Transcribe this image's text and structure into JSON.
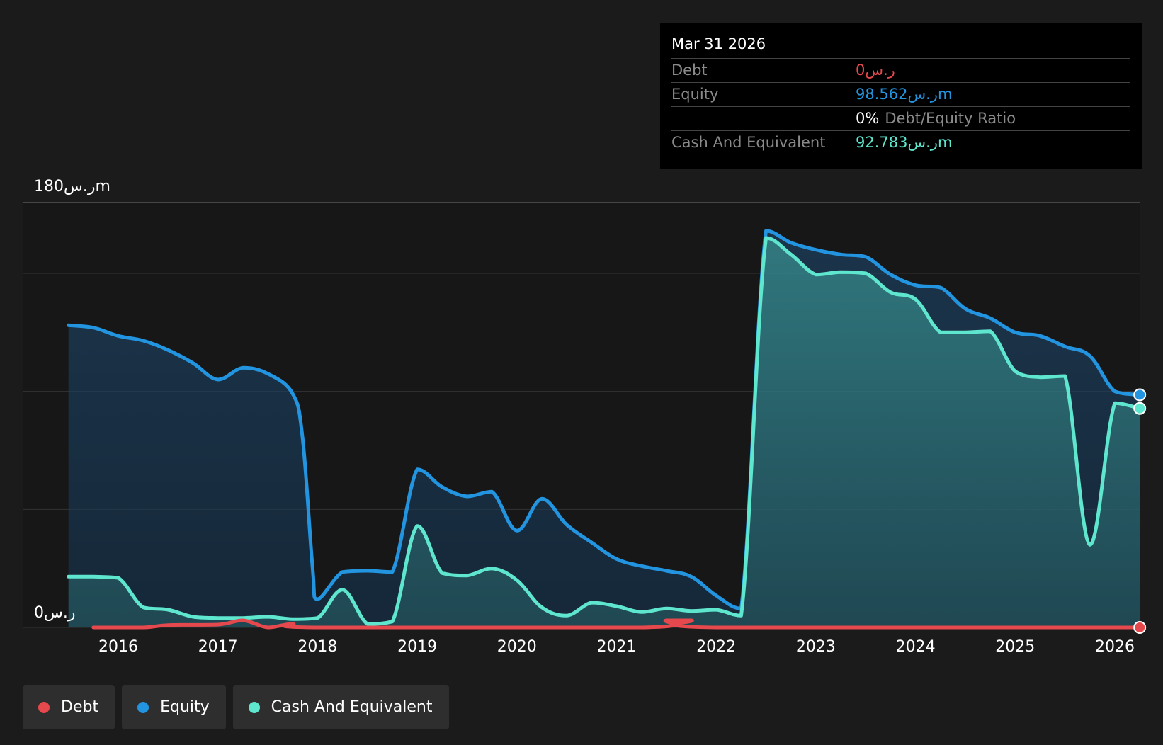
{
  "colors": {
    "background": "#1b1b1b",
    "debt": "#e5484d",
    "equity": "#2394df",
    "cash": "#5ee6cf",
    "grid": "#333333"
  },
  "tooltip": {
    "date": "Mar 31 2026",
    "debt_label": "Debt",
    "debt_value": "0ر.س",
    "equity_label": "Equity",
    "equity_value": "98.562ر.سm",
    "ratio_value": "0%",
    "ratio_label": "Debt/Equity Ratio",
    "cash_label": "Cash And Equivalent",
    "cash_value": "92.783ر.سm"
  },
  "legend": {
    "debt": "Debt",
    "equity": "Equity",
    "cash": "Cash And Equivalent"
  },
  "chart_data": {
    "type": "area",
    "y_top_label": "180ر.سm",
    "y_bottom_label": "0ر.س",
    "ylim": [
      0,
      180
    ],
    "xlim": [
      2015.1,
      2026.3
    ],
    "x_ticks": [
      "2016",
      "2017",
      "2018",
      "2019",
      "2020",
      "2021",
      "2022",
      "2023",
      "2024",
      "2025",
      "2026"
    ],
    "grid": true,
    "legend_position": "bottom-left",
    "series": [
      {
        "name": "Equity",
        "color": "#2394df",
        "points": [
          [
            2015.5,
            128
          ],
          [
            2015.75,
            127
          ],
          [
            2016.0,
            123.5
          ],
          [
            2016.25,
            121.5
          ],
          [
            2016.5,
            117.5
          ],
          [
            2016.75,
            112
          ],
          [
            2017.0,
            105
          ],
          [
            2017.25,
            110
          ],
          [
            2017.5,
            107.5
          ],
          [
            2017.75,
            99
          ],
          [
            2017.85,
            80
          ],
          [
            2017.95,
            25
          ],
          [
            2018.0,
            12
          ],
          [
            2018.25,
            23.5
          ],
          [
            2018.5,
            24
          ],
          [
            2018.75,
            23.5
          ],
          [
            2019.0,
            67
          ],
          [
            2019.25,
            59.5
          ],
          [
            2019.5,
            55.5
          ],
          [
            2019.75,
            57.5
          ],
          [
            2020.0,
            41
          ],
          [
            2020.25,
            54.5
          ],
          [
            2020.5,
            43.5
          ],
          [
            2020.75,
            36
          ],
          [
            2021.0,
            29
          ],
          [
            2021.25,
            26
          ],
          [
            2021.5,
            24
          ],
          [
            2021.75,
            21.5
          ],
          [
            2022.0,
            13.5
          ],
          [
            2022.25,
            8
          ],
          [
            2022.5,
            168
          ],
          [
            2022.75,
            163
          ],
          [
            2023.0,
            160
          ],
          [
            2023.25,
            158
          ],
          [
            2023.5,
            157
          ],
          [
            2023.75,
            149.5
          ],
          [
            2024.0,
            145
          ],
          [
            2024.25,
            144
          ],
          [
            2024.5,
            135
          ],
          [
            2024.75,
            131
          ],
          [
            2025.0,
            125
          ],
          [
            2025.25,
            123.5
          ],
          [
            2025.5,
            119
          ],
          [
            2025.75,
            115
          ],
          [
            2026.0,
            100
          ],
          [
            2026.25,
            98.562
          ]
        ]
      },
      {
        "name": "Cash And Equivalent",
        "color": "#5ee6cf",
        "points": [
          [
            2015.5,
            21.5
          ],
          [
            2015.75,
            21.5
          ],
          [
            2016.0,
            21
          ],
          [
            2016.25,
            8.5
          ],
          [
            2016.5,
            7.5
          ],
          [
            2016.75,
            4.5
          ],
          [
            2017.0,
            4
          ],
          [
            2017.25,
            4
          ],
          [
            2017.5,
            4.5
          ],
          [
            2017.75,
            3.5
          ],
          [
            2018.0,
            4
          ],
          [
            2018.25,
            16
          ],
          [
            2018.5,
            1.5
          ],
          [
            2018.75,
            2.5
          ],
          [
            2019.0,
            43
          ],
          [
            2019.25,
            23
          ],
          [
            2019.5,
            22
          ],
          [
            2019.75,
            25
          ],
          [
            2020.0,
            20
          ],
          [
            2020.25,
            8.5
          ],
          [
            2020.5,
            5
          ],
          [
            2020.75,
            10.5
          ],
          [
            2021.0,
            9
          ],
          [
            2021.25,
            6.5
          ],
          [
            2021.5,
            8
          ],
          [
            2021.75,
            7
          ],
          [
            2022.0,
            7.5
          ],
          [
            2022.25,
            5
          ],
          [
            2022.5,
            165
          ],
          [
            2022.75,
            158
          ],
          [
            2023.0,
            149.5
          ],
          [
            2023.25,
            150.5
          ],
          [
            2023.5,
            150
          ],
          [
            2023.75,
            142
          ],
          [
            2024.0,
            139
          ],
          [
            2024.25,
            125
          ],
          [
            2024.5,
            125
          ],
          [
            2024.75,
            125.5
          ],
          [
            2025.0,
            108.5
          ],
          [
            2025.25,
            106
          ],
          [
            2025.5,
            106.5
          ],
          [
            2025.75,
            35
          ],
          [
            2026.0,
            95
          ],
          [
            2026.25,
            92.783
          ]
        ]
      },
      {
        "name": "Debt",
        "color": "#e5484d",
        "points": [
          [
            2015.75,
            0
          ],
          [
            2016.25,
            0
          ],
          [
            2016.5,
            1
          ],
          [
            2017.0,
            1.2
          ],
          [
            2017.25,
            3
          ],
          [
            2017.5,
            0
          ],
          [
            2017.75,
            1.5
          ],
          [
            2018.0,
            0
          ],
          [
            2021.25,
            0
          ],
          [
            2021.5,
            3
          ],
          [
            2021.75,
            3
          ],
          [
            2022.0,
            0
          ],
          [
            2026.25,
            0
          ]
        ]
      }
    ]
  }
}
